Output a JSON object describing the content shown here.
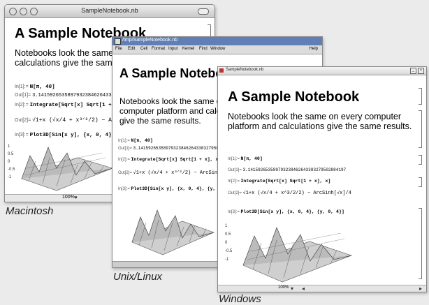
{
  "mac": {
    "window_title": "SampleNotebook.nb",
    "notebook_title": "A Sample Notebook",
    "paragraph": "Notebooks look the same on every computer platform and calculations give the same results.",
    "in1_label": "In[1]:=",
    "in1_code": "N[π, 40]",
    "out1_label": "Out[1]=",
    "out1_value": "3.141592653589793238462643383279502884197",
    "in2_label": "In[2]:=",
    "in2_code": "Integrate[Sqrt[x] Sqrt[1 + x], x]",
    "out2_label": "Out[2]=",
    "in3_label": "In[3]:=",
    "in3_code": "Plot3D[Sin[x y], {x, 0, 4}, {y, 0, 4}]",
    "zoom": "100%",
    "platform_label": "Macintosh"
  },
  "unix": {
    "window_title": "/tmp/SampleNotebook.nb",
    "menu": [
      "File",
      "Edit",
      "Cell",
      "Format",
      "Input",
      "Kernel",
      "Find",
      "Window"
    ],
    "help": "Help",
    "notebook_title": "A Sample Notebook",
    "paragraph": "Notebooks look the same on every computer platform and calculations give the same results.",
    "in1_label": "In[1]:=",
    "in1_code": "N[π, 40]",
    "out1_label": "Out[1]=",
    "out1_value": "3.141592653589793238462643383279502884197",
    "in2_label": "In[2]:=",
    "in2_code": "Integrate[Sqrt[x] Sqrt[1 + x], x]",
    "out2_label": "Out[2]=",
    "in3_label": "In[3]:=",
    "in3_code": "Plot3D[Sin[x y], {x, 0, 4}, {y, 0, 4}]",
    "platform_label": "Unix/Linux"
  },
  "win": {
    "window_title": "SampleNotebook.nb",
    "notebook_title": "A Sample Notebook",
    "paragraph": "Notebooks look the same on every computer platform and calculations give the same results.",
    "in1_label": "In[1]:=",
    "in1_code": "N[π, 40]",
    "out1_label": "Out[1]=",
    "out1_value": "3.141592653589793238462643383279502884197",
    "in2_label": "In[2]:=",
    "in2_code": "Integrate[Sqrt[x] Sqrt[1 + x], x]",
    "out2_label": "Out[2]=",
    "out2_math": "√1+x (√x/4 + x^3/2/2) − ArcSinh[√x]/4",
    "in3_label": "In[3]:=",
    "in3_code": "Plot3D[Sin[x y], {x, 0, 4}, {y, 0, 4}]",
    "zoom": "100%",
    "platform_label": "Windows"
  },
  "plot_ticks": [
    "1",
    "0.5",
    "0",
    "-0.5",
    "-1"
  ],
  "colors": {
    "mac_titlebar": "#d8d8d8",
    "unix_titlebar": "#4a6ea8",
    "win_titlebar": "#e4e4e4"
  }
}
